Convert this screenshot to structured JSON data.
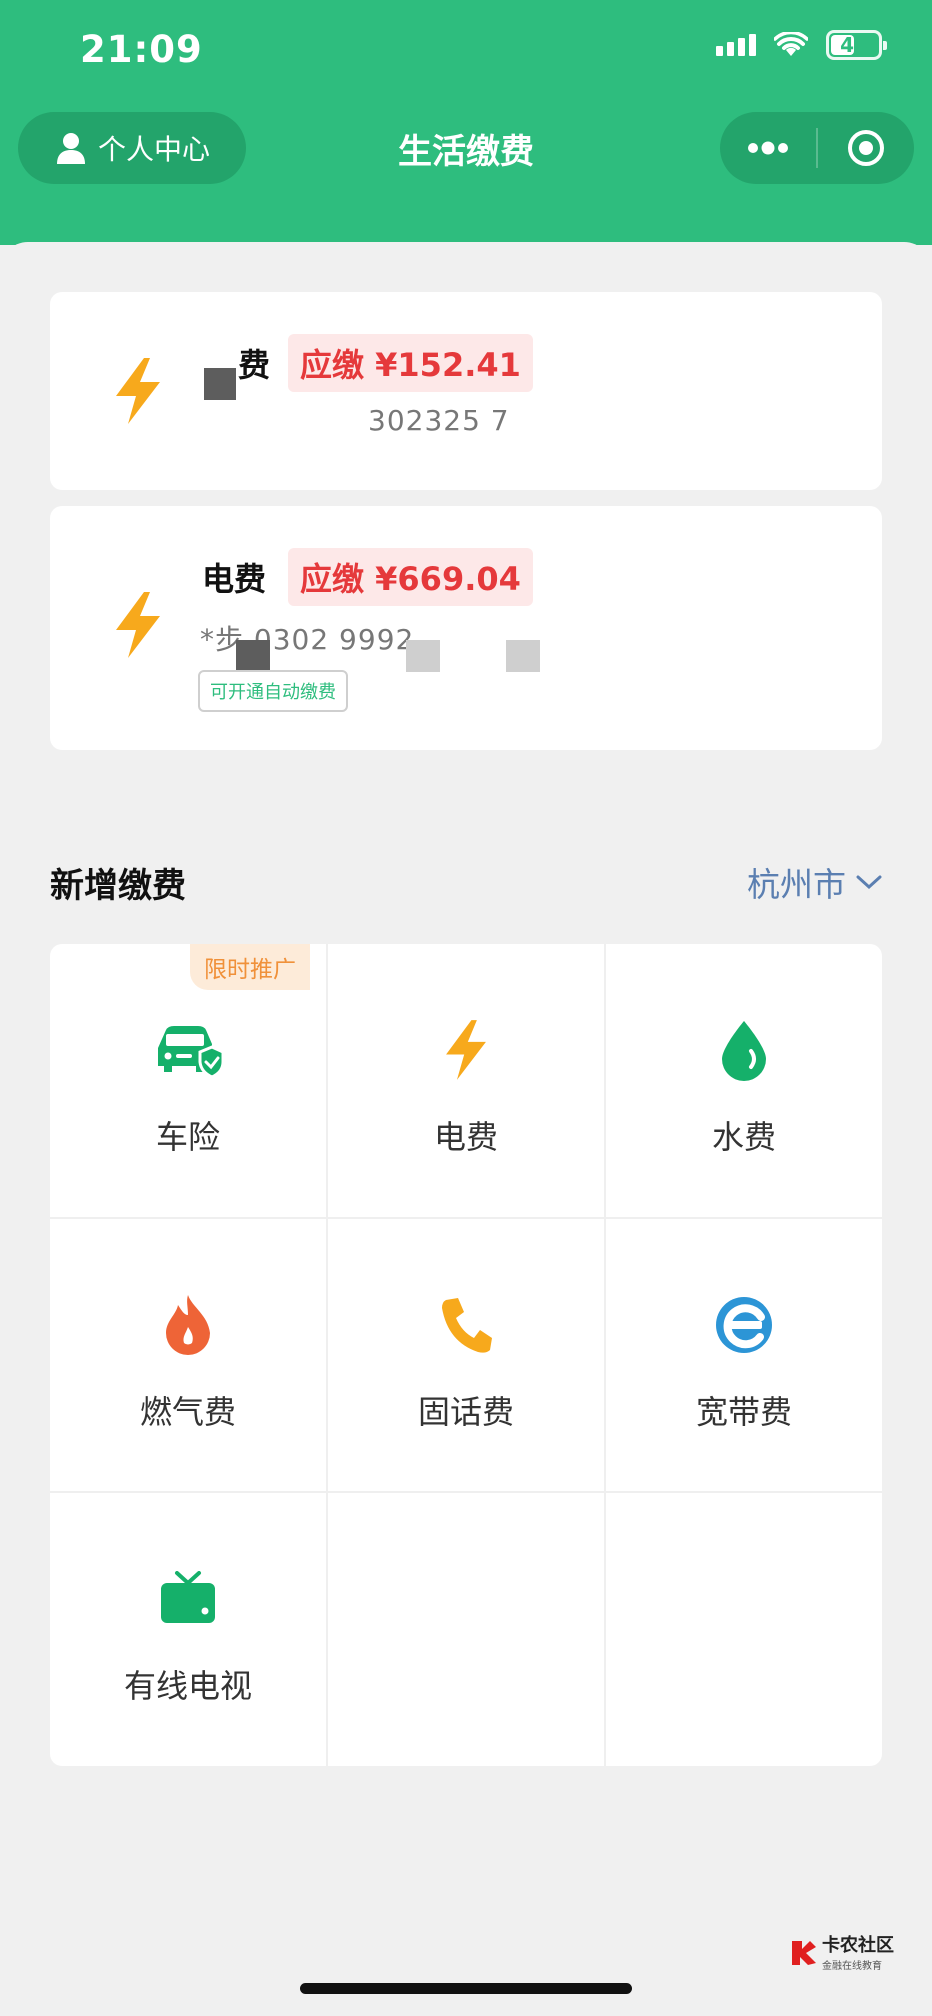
{
  "status_bar": {
    "time": "21:09",
    "battery": "45"
  },
  "nav": {
    "personal_center": "个人中心",
    "title": "生活缴费"
  },
  "bills": [
    {
      "title_suffix": "费",
      "amount": "应缴 ¥152.41",
      "account": "302325      7"
    },
    {
      "title": "电费",
      "amount": "应缴 ¥669.04",
      "account": "*步     0302    9992  ",
      "auto_pay": "可开通自动缴费"
    }
  ],
  "new_payment": {
    "title": "新增缴费",
    "city": "杭州市",
    "promo_tag": "限时推广",
    "items": [
      {
        "label": "车险"
      },
      {
        "label": "电费"
      },
      {
        "label": "水费"
      },
      {
        "label": "燃气费"
      },
      {
        "label": "固话费"
      },
      {
        "label": "宽带费"
      },
      {
        "label": "有线电视"
      }
    ]
  },
  "watermark": {
    "main": "卡农社区",
    "sub": "金融在线教育"
  },
  "colors": {
    "brand_green": "#2ebd7e",
    "amount_red": "#e5393b",
    "lightning_yellow": "#f7a91c",
    "city_blue": "#5b7fb1"
  }
}
